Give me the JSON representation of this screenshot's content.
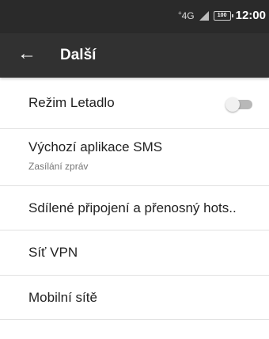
{
  "status_bar": {
    "network": "4G",
    "network_prefix": "+",
    "battery_level": "100",
    "time": "12:00"
  },
  "header": {
    "back_glyph": "←",
    "title": "Další"
  },
  "settings": {
    "items": [
      {
        "label": "Režim Letadlo",
        "toggle": "off"
      },
      {
        "label": "Výchozí aplikace SMS",
        "sublabel": "Zasílání zpráv"
      },
      {
        "label": "Sdílené připojení a přenosný hots.."
      },
      {
        "label": "Síť VPN"
      },
      {
        "label": "Mobilní sítě"
      }
    ]
  },
  "colors": {
    "status_bar": "#2a2a2a",
    "app_bar": "#313131",
    "text": "#212121",
    "secondary_text": "#767676",
    "divider": "#e2e2e2"
  }
}
